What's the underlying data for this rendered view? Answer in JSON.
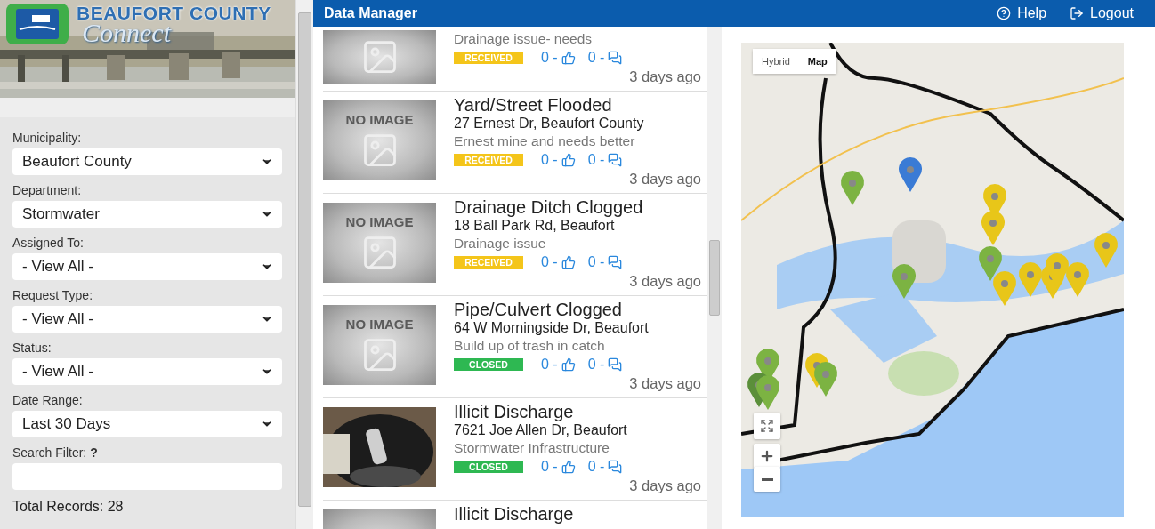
{
  "banner": {
    "title": "BEAUFORT COUNTY",
    "subtitle": "Connect"
  },
  "filters": [
    {
      "label": "Municipality:",
      "value": "Beaufort County"
    },
    {
      "label": "Department:",
      "value": "Stormwater"
    },
    {
      "label": "Assigned To:",
      "value": "- View All -"
    },
    {
      "label": "Request Type:",
      "value": "- View All -"
    },
    {
      "label": "Status:",
      "value": "- View All -"
    },
    {
      "label": "Date Range:",
      "value": "Last 30 Days"
    }
  ],
  "search": {
    "label": "Search Filter: **?**"
  },
  "total": "Total Records: 28",
  "header": {
    "title": "Data Manager",
    "links": [
      {
        "kind": "help",
        "label": "Help"
      },
      {
        "kind": "logout",
        "label": "Logout"
      }
    ]
  },
  "requests": [
    {
      "image": {
        "kind": "placeholder"
      },
      "description": "Drainage issue- needs",
      "status": {
        "kind": "received",
        "label": "RECEIVED"
      },
      "likes": "0 -",
      "comments": "0 -",
      "time": "3 days ago"
    },
    {
      "image": {
        "kind": "placeholder",
        "label": "NO IMAGE"
      },
      "title": "Yard/Street Flooded",
      "address": "27 Ernest Dr, Beaufort County",
      "description": "Ernest mine and needs better",
      "status": {
        "kind": "received",
        "label": "RECEIVED"
      },
      "likes": "0 -",
      "comments": "0 -",
      "time": "3 days ago"
    },
    {
      "image": {
        "kind": "placeholder",
        "label": "NO IMAGE"
      },
      "title": "Drainage Ditch Clogged",
      "address": "18 Ball Park Rd, Beaufort",
      "description": "Drainage issue",
      "status": {
        "kind": "received",
        "label": "RECEIVED"
      },
      "likes": "0 -",
      "comments": "0 -",
      "time": "3 days ago"
    },
    {
      "image": {
        "kind": "placeholder",
        "label": "NO IMAGE"
      },
      "title": "Pipe/Culvert Clogged",
      "address": "64 W Morningside Dr, Beaufort",
      "description": "Build up of trash in catch",
      "status": {
        "kind": "closed",
        "label": "CLOSED"
      },
      "likes": "0 -",
      "comments": "0 -",
      "time": "3 days ago"
    },
    {
      "title": "Illicit Discharge",
      "address": "7621 Joe Allen Dr, Beaufort",
      "description": "Stormwater Infrastructure",
      "status": {
        "kind": "closed",
        "label": "CLOSED"
      },
      "likes": "0 -",
      "comments": "0 -",
      "time": "3 days ago"
    },
    {
      "image": {
        "kind": "placeholder"
      },
      "title": "Illicit Discharge"
    }
  ],
  "map": {
    "types": [
      {
        "label": "Hybrid",
        "selected": false
      },
      {
        "label": "Map",
        "selected": true
      }
    ]
  }
}
